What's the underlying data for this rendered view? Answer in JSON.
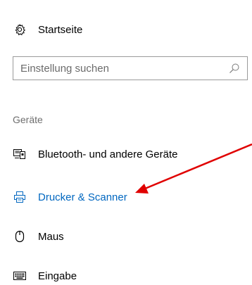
{
  "home": {
    "label": "Startseite",
    "icon": "gear-icon"
  },
  "search": {
    "placeholder": "Einstellung suchen",
    "icon": "search-icon"
  },
  "section": {
    "title": "Geräte"
  },
  "nav": {
    "items": [
      {
        "label": "Bluetooth- und andere Geräte",
        "icon": "bluetooth-devices-icon",
        "active": false
      },
      {
        "label": "Drucker & Scanner",
        "icon": "printer-icon",
        "active": true
      },
      {
        "label": "Maus",
        "icon": "mouse-icon",
        "active": false
      },
      {
        "label": "Eingabe",
        "icon": "keyboard-icon",
        "active": false
      }
    ]
  },
  "colors": {
    "accent": "#0067c0",
    "annotation_arrow": "#e00000",
    "section_text": "#6e6e6e"
  }
}
